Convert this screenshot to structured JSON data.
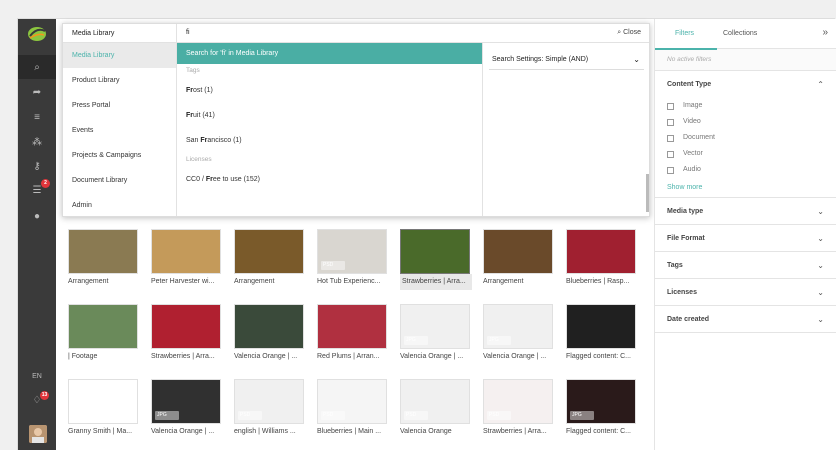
{
  "search": {
    "query": "fi",
    "close_label": "Close",
    "settings_label": "Search Settings: Simple (AND)"
  },
  "scopes": {
    "header": "Media Library",
    "items": [
      "Media Library",
      "Product Library",
      "Press Portal",
      "Events",
      "Projects & Campaigns",
      "Document Library",
      "Admin"
    ]
  },
  "results": {
    "highlight": "Search for 'fi' in Media Library",
    "tags_label": "Tags",
    "tags": [
      {
        "bold": "Fr",
        "rest": "ost (1)"
      },
      {
        "bold": "Fr",
        "rest": "uit (41)"
      },
      {
        "pre": "San ",
        "bold": "Fr",
        "rest": "ancisco (1)"
      }
    ],
    "licenses_label": "Licenses",
    "licenses": [
      {
        "pre": "CC0 / ",
        "bold": "Fr",
        "rest": "ee to use (152)"
      }
    ]
  },
  "rail": {
    "lang": "EN",
    "badge_tasks": "2",
    "badge_notifications": "13"
  },
  "filters": {
    "tab_filters": "Filters",
    "tab_collections": "Collections",
    "no_active": "No active filters",
    "content_type_label": "Content Type",
    "content_types": [
      "Image",
      "Video",
      "Document",
      "Vector",
      "Audio"
    ],
    "show_more": "Show more",
    "sections": [
      "Media type",
      "File Format",
      "Tags",
      "Licenses",
      "Date created"
    ]
  },
  "grid": {
    "rows": [
      [
        {
          "caption": "Arrangement",
          "tag": ""
        },
        {
          "caption": "Peter Harvester wi...",
          "tag": ""
        },
        {
          "caption": "Arrangement",
          "tag": ""
        },
        {
          "caption": "Hot Tub Experienc...",
          "tag": "PSD"
        },
        {
          "caption": "Strawberries | Arra...",
          "tag": "",
          "selected": true
        },
        {
          "caption": "Arrangement",
          "tag": ""
        },
        {
          "caption": "Blueberries | Rasp...",
          "tag": ""
        }
      ],
      [
        {
          "caption": "| Footage",
          "tag": ""
        },
        {
          "caption": "Strawberries | Arra...",
          "tag": ""
        },
        {
          "caption": "Valencia Orange | ...",
          "tag": ""
        },
        {
          "caption": "Red Plums | Arran...",
          "tag": ""
        },
        {
          "caption": "Valencia Orange | ...",
          "tag": "JPG"
        },
        {
          "caption": "Valencia Orange | ...",
          "tag": "JPG"
        },
        {
          "caption": "Flagged content: C...",
          "tag": ""
        }
      ],
      [
        {
          "caption": "Granny Smith | Ma...",
          "tag": "PSD"
        },
        {
          "caption": "Valencia Orange | ...",
          "tag": "JPG"
        },
        {
          "caption": "english | Williams ...",
          "tag": "PSD"
        },
        {
          "caption": "Blueberries | Main ...",
          "tag": "PSD"
        },
        {
          "caption": "Valencia Orange",
          "tag": "PSD"
        },
        {
          "caption": "Strawberries | Arra...",
          "tag": "PSD"
        },
        {
          "caption": "Flagged content: C...",
          "tag": "JPG"
        }
      ]
    ],
    "colors": [
      [
        "#8a7a52",
        "#c49a5a",
        "#7a5a2a",
        "#d9d6d0",
        "#4a6a2a",
        "#6a4a2a",
        "#a02030"
      ],
      [
        "#6a8a5a",
        "#b02030",
        "#3a4a3a",
        "#b03040",
        "#f0f0f0",
        "#f0f0f0",
        "#202020"
      ],
      [
        "#ffffff",
        "#303030",
        "#f0f0f0",
        "#f5f5f5",
        "#f0f0f0",
        "#f5f0f0",
        "#2a1a1a"
      ]
    ]
  }
}
